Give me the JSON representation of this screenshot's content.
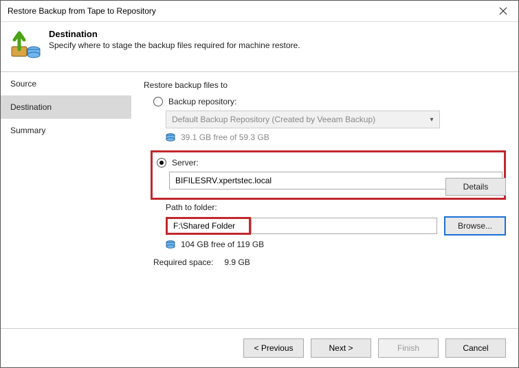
{
  "window": {
    "title": "Restore Backup from Tape to Repository"
  },
  "header": {
    "title": "Destination",
    "subtitle": "Specify where to stage the backup files required for machine restore."
  },
  "sidebar": {
    "steps": [
      "Source",
      "Destination",
      "Summary"
    ]
  },
  "main": {
    "section_title": "Restore backup files to",
    "options": {
      "repo": {
        "label": "Backup repository:",
        "selected": "Default Backup Repository (Created by Veeam Backup)",
        "free_text": "39.1 GB free of 59.3 GB"
      },
      "server": {
        "label": "Server:",
        "selected": "BIFILESRV.xpertstec.local",
        "details_btn": "Details"
      }
    },
    "path": {
      "label": "Path to folder:",
      "value": "F:\\Shared Folder",
      "browse_btn": "Browse...",
      "free_text": "104 GB free of 119 GB"
    },
    "required": {
      "label": "Required space:",
      "value": "9.9 GB"
    }
  },
  "footer": {
    "previous": "< Previous",
    "next": "Next >",
    "finish": "Finish",
    "cancel": "Cancel"
  },
  "colors": {
    "highlight": "#c1272d",
    "accent": "#1a6fd8"
  }
}
